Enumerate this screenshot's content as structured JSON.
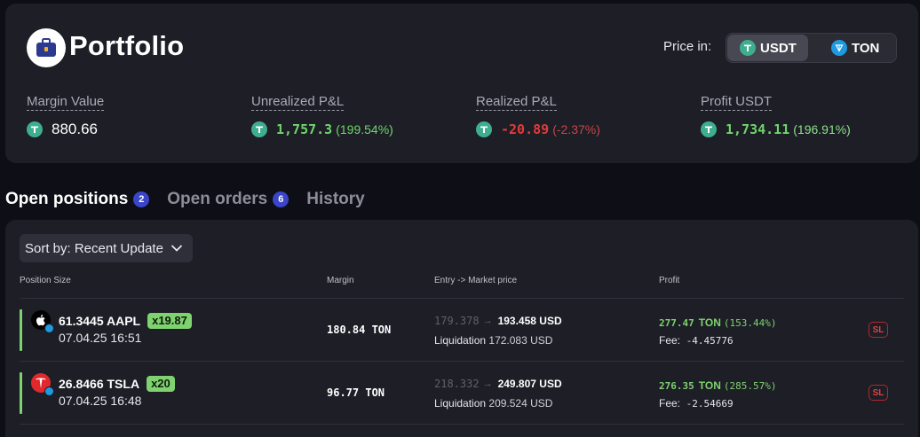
{
  "header": {
    "title": "Portfolio",
    "price_in_label": "Price in:",
    "currency_options": [
      "USDT",
      "TON"
    ],
    "selected_currency": "USDT"
  },
  "metrics": [
    {
      "label": "Margin Value",
      "value": "880.66",
      "pct": ""
    },
    {
      "label": "Unrealized P&L",
      "value": "1,757.3",
      "pct": "(199.54%)"
    },
    {
      "label": "Realized P&L",
      "value": "-20.89",
      "pct": "(-2.37%)"
    },
    {
      "label": "Profit USDT",
      "value": "1,734.11",
      "pct": "(196.91%)"
    }
  ],
  "tabs": [
    {
      "label": "Open positions",
      "count": "2",
      "active": true
    },
    {
      "label": "Open orders",
      "count": "6",
      "active": false
    },
    {
      "label": "History",
      "count": "",
      "active": false
    }
  ],
  "sort": {
    "label": "Sort by: Recent Update"
  },
  "table": {
    "headers": [
      "Position Size",
      "Margin",
      "Entry -> Market price",
      "Profit"
    ],
    "rows": [
      {
        "size": "61.3445 AAPL",
        "leverage": "x19.87",
        "date": "07.04.25 16:51",
        "margin": "180.84 TON",
        "entry_price": "179.378",
        "market_price": "193.458 USD",
        "liquidation_label": "Liquidation",
        "liquidation_value": "172.083 USD",
        "profit_value": "277.47",
        "profit_unit": "TON",
        "profit_pct": "(153.44%)",
        "fee_label": "Fee:",
        "fee_value": "-4.45776",
        "sl_label": "SL"
      },
      {
        "size": "26.8466 TSLA",
        "leverage": "x20",
        "date": "07.04.25 16:48",
        "margin": "96.77 TON",
        "entry_price": "218.332",
        "market_price": "249.807 USD",
        "liquidation_label": "Liquidation",
        "liquidation_value": "209.524 USD",
        "profit_value": "276.35",
        "profit_unit": "TON",
        "profit_pct": "(285.57%)",
        "fee_label": "Fee:",
        "fee_value": "-2.54669",
        "sl_label": "SL"
      }
    ]
  },
  "colors": {
    "background": "#0d0e16",
    "card": "#1d1e26",
    "positive": "#6fd66a",
    "negative": "#e23b3b",
    "usdt": "#3eae8f",
    "ton": "#1f9ae0",
    "badge": "#3a45c8"
  },
  "icons": {
    "logo": "briefcase-icon",
    "usdt": "tether-icon",
    "ton": "ton-icon",
    "sort": "chevron-down-icon",
    "apple": "apple-icon",
    "tesla": "tesla-icon"
  }
}
